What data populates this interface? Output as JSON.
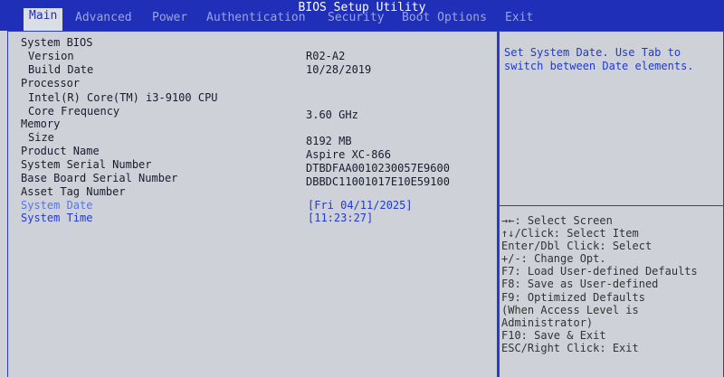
{
  "title": "BIOS Setup Utility",
  "menu": {
    "tabs": [
      {
        "label": "Main",
        "active": true
      },
      {
        "label": "Advanced"
      },
      {
        "label": "Power"
      },
      {
        "label": "Authentication"
      },
      {
        "label": "Security"
      },
      {
        "label": "Boot Options"
      },
      {
        "label": "Exit"
      }
    ]
  },
  "main": {
    "rows": [
      {
        "label": "System BIOS",
        "value": ""
      },
      {
        "label": "Version",
        "value": "R02-A2"
      },
      {
        "label": "Build Date",
        "value": "10/28/2019"
      },
      {
        "label": "Processor",
        "value": ""
      },
      {
        "label": "Intel(R) Core(TM) i3-9100 CPU",
        "value": ""
      },
      {
        "label": "Core Frequency",
        "value": "3.60 GHz"
      },
      {
        "label": "Memory",
        "value": ""
      },
      {
        "label": "Size",
        "value": "8192 MB"
      },
      {
        "label": "Product Name",
        "value": "Aspire XC-866"
      },
      {
        "label": "System Serial Number",
        "value": "DTBDFAA0010230057E9600"
      },
      {
        "label": "Base Board Serial Number",
        "value": "DBBDC11001017E10E59100"
      },
      {
        "label": "Asset Tag Number",
        "value": ""
      },
      {
        "label": "System Date",
        "value": "[Fri 04/11/2025]"
      },
      {
        "label": "System Time",
        "value": "[11:23:27]"
      }
    ]
  },
  "help": {
    "description": "Set System Date. Use Tab to switch between Date elements.",
    "keys": [
      "→←: Select Screen",
      "↑↓/Click: Select Item",
      "Enter/Dbl Click: Select",
      "+/-: Change Opt.",
      "F7: Load User-defined Defaults",
      "F8: Save as User-defined",
      "F9: Optimized Defaults",
      "(When Access Level is",
      "Administrator)",
      "F10: Save & Exit",
      "ESC/Right Click: Exit"
    ]
  },
  "colors": {
    "bar": "#1f2fb8",
    "background": "#cfd1d8",
    "highlight": "#1f3ad0"
  }
}
